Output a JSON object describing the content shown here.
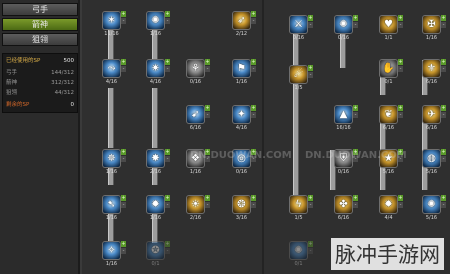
{
  "sidebar": {
    "tabs": [
      {
        "label": "弓手",
        "active": false
      },
      {
        "label": "箭神",
        "active": true
      },
      {
        "label": "狙翎",
        "active": false
      }
    ],
    "stats": [
      {
        "label": "已经使用的SP",
        "value": "500",
        "style": "highlight"
      },
      {
        "label": "弓手",
        "value": "144/312",
        "style": "normal"
      },
      {
        "label": "箭神",
        "value": "312/312",
        "style": "normal"
      },
      {
        "label": "狙翎",
        "value": "44/312",
        "style": "normal"
      },
      {
        "label": "剩余的SP",
        "value": "0",
        "style": "remain"
      }
    ]
  },
  "tree1": {
    "skills": [
      {
        "label": "11/16",
        "icon": "arrow-burst-icon",
        "glyph": "✶",
        "tone": "blue"
      },
      {
        "label": "1/16",
        "icon": "spiral-shot-icon",
        "glyph": "✺",
        "tone": "blue"
      },
      {
        "label": "2/12",
        "icon": "bow-gold-icon",
        "glyph": "➶",
        "tone": "gold"
      },
      {
        "label": "4/16",
        "icon": "multi-arrow-icon",
        "glyph": "⤳",
        "tone": "blue"
      },
      {
        "label": "4/16",
        "icon": "whirl-icon",
        "glyph": "✷",
        "tone": "blue"
      },
      {
        "label": "0/16",
        "icon": "crouch-icon",
        "glyph": "⚘",
        "tone": "grey"
      },
      {
        "label": "1/16",
        "icon": "leap-icon",
        "glyph": "⚑",
        "tone": "blue"
      },
      {
        "label": "6/16",
        "icon": "dash-icon",
        "glyph": "➹",
        "tone": "blue"
      },
      {
        "label": "4/16",
        "icon": "claw-icon",
        "glyph": "✦",
        "tone": "blue"
      },
      {
        "label": "1/16",
        "icon": "arrow-rain-icon",
        "glyph": "✵",
        "tone": "blue"
      },
      {
        "label": "2/16",
        "icon": "cross-shot-icon",
        "glyph": "✸",
        "tone": "blue"
      },
      {
        "label": "1/16",
        "icon": "trap-icon",
        "glyph": "❖",
        "tone": "grey"
      },
      {
        "label": "0/16",
        "icon": "orb-icon",
        "glyph": "◎",
        "tone": "blue"
      },
      {
        "label": "1/16",
        "icon": "flame-arrow-icon",
        "glyph": "➷",
        "tone": "blue"
      },
      {
        "label": "1/16",
        "icon": "sonic-icon",
        "glyph": "✹",
        "tone": "blue"
      },
      {
        "label": "2/16",
        "icon": "sun-icon",
        "glyph": "☀",
        "tone": "gold"
      },
      {
        "label": "3/16",
        "icon": "eagle-icon",
        "glyph": "❂",
        "tone": "gold"
      },
      {
        "label": "1/16",
        "icon": "aura-icon",
        "glyph": "✧",
        "tone": "blue"
      },
      {
        "label": "0/1",
        "icon": "ultimate-icon",
        "glyph": "✪",
        "tone": "blue",
        "dim": true
      }
    ]
  },
  "tree2": {
    "skills": [
      {
        "label": "0/16",
        "icon": "slash-icon",
        "glyph": "⚔",
        "tone": "blue"
      },
      {
        "label": "0/16",
        "icon": "wind-icon",
        "glyph": "✺",
        "tone": "blue"
      },
      {
        "label": "1/1",
        "icon": "heart-shield-icon",
        "glyph": "♥",
        "tone": "gold"
      },
      {
        "label": "1/16",
        "icon": "crest-icon",
        "glyph": "✠",
        "tone": "gold"
      },
      {
        "label": "1/5",
        "icon": "flame-fist-icon",
        "glyph": "☄",
        "tone": "gold"
      },
      {
        "label": "0/1",
        "icon": "palm-icon",
        "glyph": "✋",
        "tone": "grey"
      },
      {
        "label": "6/16",
        "icon": "wolf-icon",
        "glyph": "⚜",
        "tone": "gold"
      },
      {
        "label": "16/16",
        "icon": "boot-icon",
        "glyph": "▲",
        "tone": "blue"
      },
      {
        "label": "6/16",
        "icon": "feather-icon",
        "glyph": "❦",
        "tone": "gold"
      },
      {
        "label": "6/16",
        "icon": "bird-icon",
        "glyph": "✈",
        "tone": "gold"
      },
      {
        "label": "0/16",
        "icon": "shield-icon",
        "glyph": "⛨",
        "tone": "grey"
      },
      {
        "label": "5/16",
        "icon": "star-icon",
        "glyph": "★",
        "tone": "gold"
      },
      {
        "label": "5/16",
        "icon": "ring-icon",
        "glyph": "◍",
        "tone": "blue"
      },
      {
        "label": "1/5",
        "icon": "lightning-icon",
        "glyph": "ϟ",
        "tone": "gold"
      },
      {
        "label": "6/16",
        "icon": "fox-icon",
        "glyph": "✤",
        "tone": "gold"
      },
      {
        "label": "4/4",
        "icon": "ember-icon",
        "glyph": "✹",
        "tone": "gold"
      },
      {
        "label": "5/16",
        "icon": "storm-icon",
        "glyph": "✺",
        "tone": "blue"
      },
      {
        "label": "0/1",
        "icon": "final-burst-icon",
        "glyph": "✺",
        "tone": "blue",
        "dim": true
      }
    ]
  },
  "watermarks": [
    "DN.DUOWAN.COM"
  ],
  "overlay_label": "脉冲手游网"
}
